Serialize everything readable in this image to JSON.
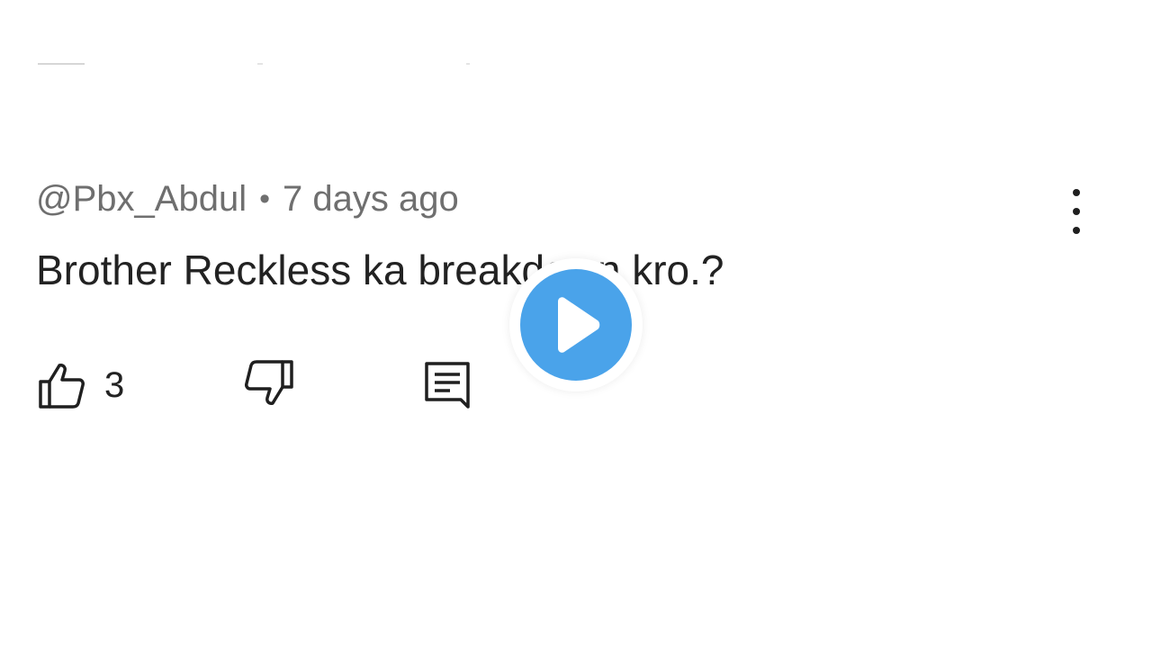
{
  "comment": {
    "author": "@Pbx_Abdul",
    "separator": "•",
    "time": "7 days ago",
    "text": "Brother Reckless ka breakdown kro.?",
    "like_count": "3"
  },
  "icons": {
    "like": "thumbs-up-icon",
    "dislike": "thumbs-down-icon",
    "reply": "comment-reply-icon",
    "more": "more-vertical-icon",
    "play": "play-icon"
  },
  "colors": {
    "meta_text": "#6f6f6f",
    "body_text": "#222222",
    "play_button": "#4aa3ea",
    "background": "#ffffff"
  }
}
